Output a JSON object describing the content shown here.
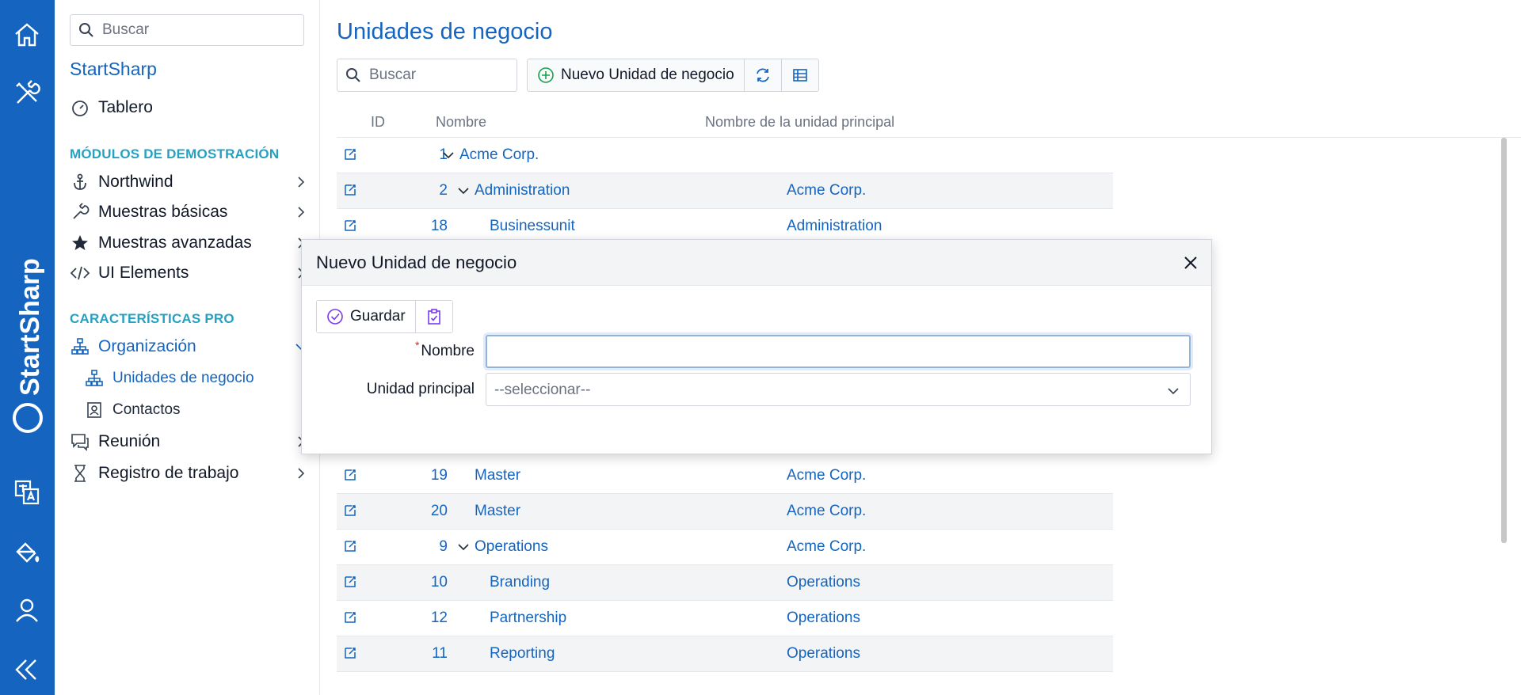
{
  "app": {
    "brand_name": "StartSharp",
    "accent_color": "#1565c0",
    "section_color": "#26a1c2"
  },
  "rail": {
    "icons": [
      "home-icon",
      "tools-icon",
      "translate-icon",
      "paint-bucket-icon",
      "user-icon",
      "collapse-icon"
    ]
  },
  "sidebar": {
    "search_placeholder": "Buscar",
    "title": "StartSharp",
    "dashboard_label": "Tablero",
    "section_demo": "MÓDULOS DE DEMOSTRACIÓN",
    "demo_items": [
      {
        "label": "Northwind",
        "icon": "anchor-icon"
      },
      {
        "label": "Muestras básicas",
        "icon": "wrench-icon"
      },
      {
        "label": "Muestras avanzadas",
        "icon": "star-icon"
      },
      {
        "label": "UI Elements",
        "icon": "code-icon"
      }
    ],
    "section_pro": "CARACTERÍSTICAS PRO",
    "org_label": "Organización",
    "org_children": [
      {
        "label": "Unidades de negocio",
        "icon": "sitemap-icon"
      },
      {
        "label": "Contactos",
        "icon": "contact-card-icon"
      }
    ],
    "meeting_label": "Reunión",
    "worklog_label": "Registro de trabajo"
  },
  "main": {
    "title": "Unidades de negocio",
    "search_placeholder": "Buscar",
    "new_button_label": "Nuevo Unidad de negocio",
    "columns": {
      "id": "ID",
      "name": "Nombre",
      "parent": "Nombre de la unidad principal"
    },
    "rows_top": [
      {
        "id": "1",
        "name": "Acme Corp.",
        "parent": "",
        "level": 0,
        "expanded": true
      },
      {
        "id": "2",
        "name": "Administration",
        "parent": "Acme Corp.",
        "level": 1,
        "expanded": true
      },
      {
        "id": "18",
        "name": "Businessunit",
        "parent": "Administration",
        "level": 2,
        "expanded": false
      }
    ],
    "rows_bottom": [
      {
        "id": "19",
        "name": "Master",
        "parent": "Acme Corp.",
        "level": 1,
        "expanded": false
      },
      {
        "id": "20",
        "name": "Master",
        "parent": "Acme Corp.",
        "level": 1,
        "expanded": false
      },
      {
        "id": "9",
        "name": "Operations",
        "parent": "Acme Corp.",
        "level": 1,
        "expanded": true
      },
      {
        "id": "10",
        "name": "Branding",
        "parent": "Operations",
        "level": 2,
        "expanded": false
      },
      {
        "id": "12",
        "name": "Partnership",
        "parent": "Operations",
        "level": 2,
        "expanded": false
      },
      {
        "id": "11",
        "name": "Reporting",
        "parent": "Operations",
        "level": 2,
        "expanded": false
      }
    ]
  },
  "dialog": {
    "title": "Nuevo Unidad de negocio",
    "save_label": "Guardar",
    "name_label": "Nombre",
    "name_value": "",
    "parent_label": "Unidad principal",
    "parent_placeholder": "--seleccionar--",
    "required_mark": "*"
  }
}
